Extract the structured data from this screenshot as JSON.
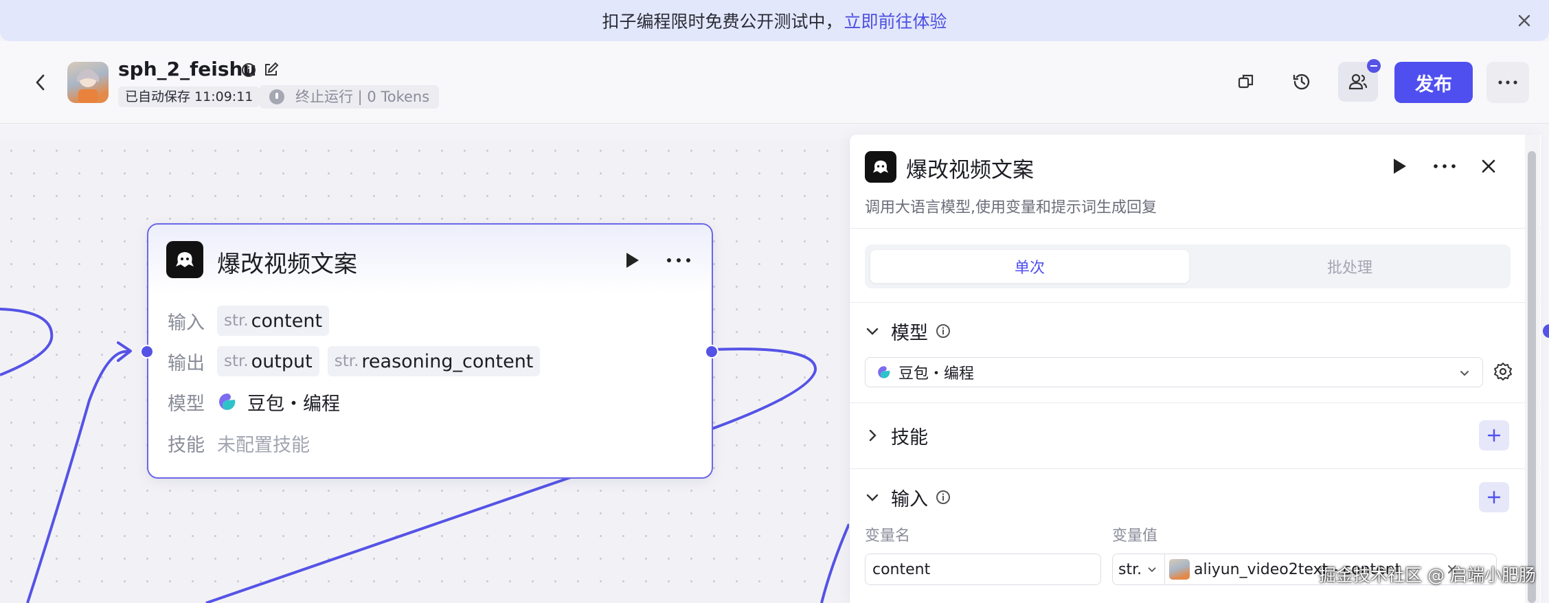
{
  "banner": {
    "text": "扣子编程限时免费公开测试中，",
    "link": "立即前往体验"
  },
  "header": {
    "app_name": "sph_2_feishu",
    "saved_status": "已自动保存 11:09:11",
    "run_status": "终止运行 | 0 Tokens",
    "publish_label": "发布"
  },
  "node": {
    "title": "爆改视频文案",
    "input_label": "输入",
    "output_label": "输出",
    "model_label": "模型",
    "skill_label": "技能",
    "inputs": [
      {
        "type": "str.",
        "name": "content"
      }
    ],
    "outputs": [
      {
        "type": "str.",
        "name": "output"
      },
      {
        "type": "str.",
        "name": "reasoning_content"
      }
    ],
    "model_value": "豆包・编程",
    "skill_value": "未配置技能"
  },
  "panel": {
    "title": "爆改视频文案",
    "description": "调用大语言模型,使用变量和提示词生成回复",
    "tabs": {
      "single": "单次",
      "batch": "批处理"
    },
    "model_section": "模型",
    "model_selected": "豆包・编程",
    "skill_section": "技能",
    "input_section": "输入",
    "col_var_name": "变量名",
    "col_var_value": "变量值",
    "var_name": "content",
    "var_type": "str.",
    "var_ref": "aliyun_video2text - content"
  },
  "watermark": "掘金技术社区 @ 启端小肥肠",
  "colors": {
    "accent": "#4f4ff0",
    "wire": "#5553e6",
    "banner_bg": "#e3e7fb"
  }
}
